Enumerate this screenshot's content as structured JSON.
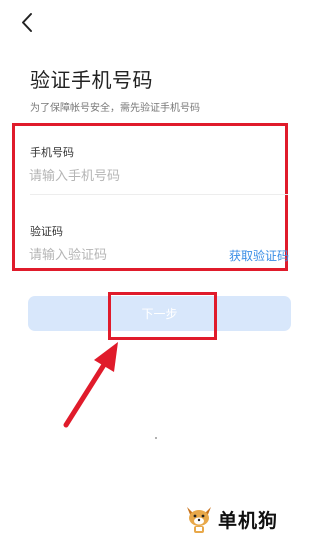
{
  "header": {
    "back_icon": "chevron-left-icon"
  },
  "page": {
    "title": "验证手机号码",
    "subtitle": "为了保障帐号安全，需先验证手机号码"
  },
  "form": {
    "phone": {
      "label": "手机号码",
      "placeholder": "请输入手机号码",
      "value": ""
    },
    "code": {
      "label": "验证码",
      "placeholder": "请输入验证码",
      "value": "",
      "get_code_label": "获取验证码"
    },
    "next_label": "下一步"
  },
  "annotations": {
    "highlight_color": "#e01b2b"
  },
  "watermark": {
    "text": "单机狗",
    "icon": "dog-mascot-icon"
  },
  "colors": {
    "accent": "#3a8ee6",
    "button_disabled_bg": "#d8e7fb"
  }
}
